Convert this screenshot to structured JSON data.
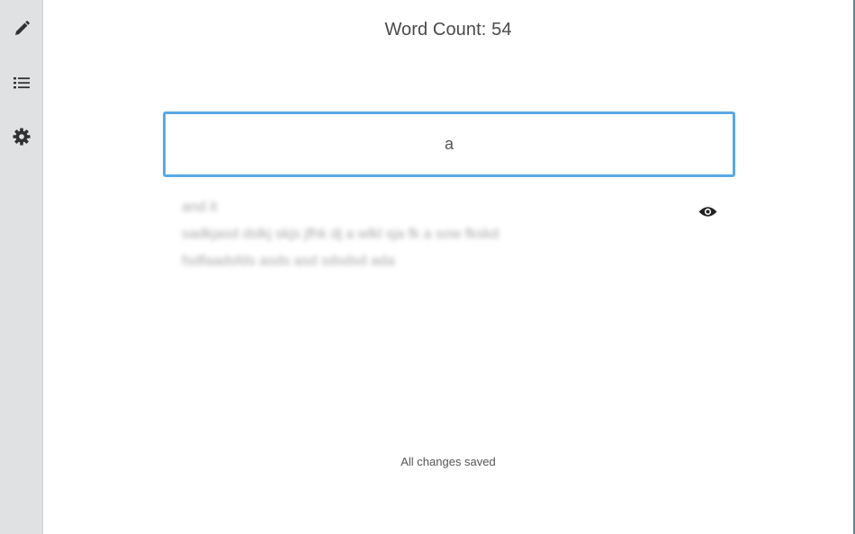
{
  "sidebar": {
    "items": [
      {
        "icon": "pencil-icon"
      },
      {
        "icon": "list-icon"
      },
      {
        "icon": "gear-icon"
      }
    ]
  },
  "header": {
    "word_count_label": "Word Count: 54"
  },
  "editor": {
    "input_value": "a"
  },
  "preview": {
    "lines": [
      "and it",
      "sadkjasd dslkj skjs jfhk dj a wlkl sja fk a sow fkskd",
      "fsdfaadsfds asds asd sdsdsd ada"
    ],
    "toggle_icon": "eye-icon"
  },
  "status": {
    "text": "All changes saved"
  },
  "colors": {
    "sidebar_bg": "#dfe1e3",
    "input_border": "#5aa9e6",
    "icon": "#2f3133"
  }
}
